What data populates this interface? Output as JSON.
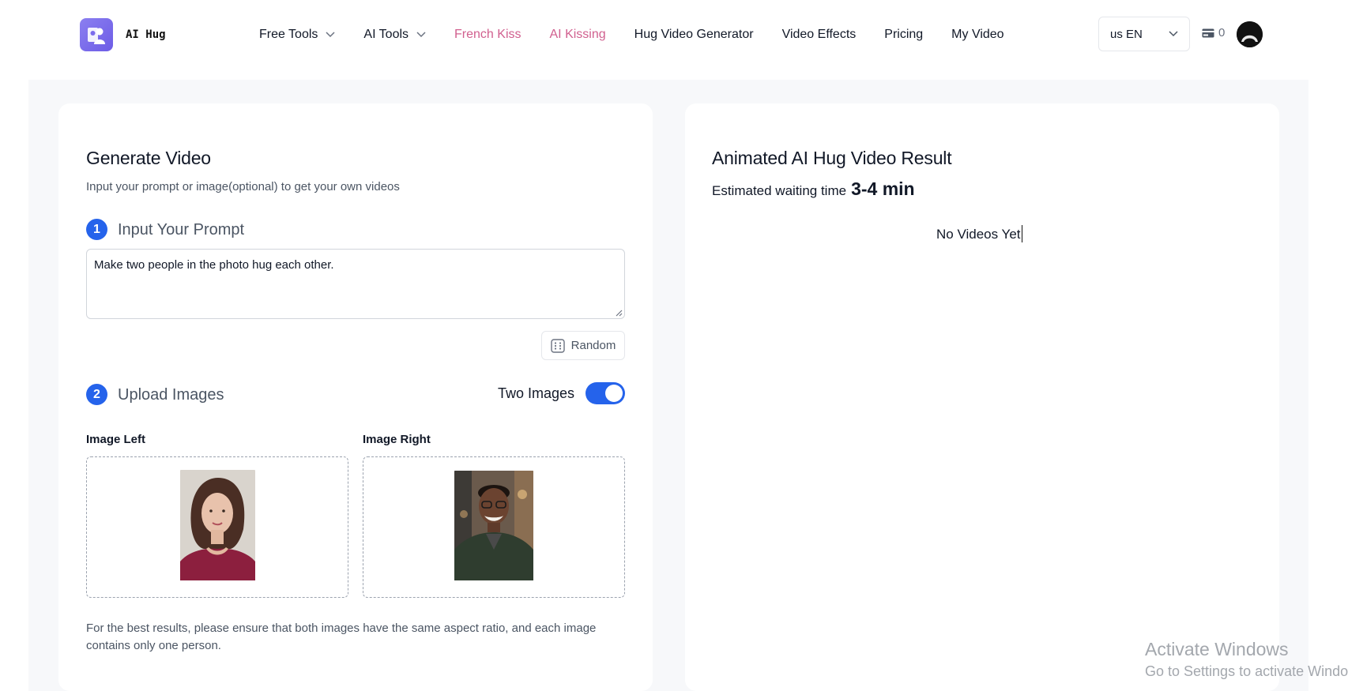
{
  "header": {
    "logo_text": "AI Hug",
    "nav": [
      {
        "label": "Free Tools",
        "dropdown": true,
        "color": "#111827"
      },
      {
        "label": "AI Tools",
        "dropdown": true,
        "color": "#111827"
      },
      {
        "label": "French Kiss",
        "dropdown": false,
        "color": "#d1608f"
      },
      {
        "label": "AI Kissing",
        "dropdown": false,
        "color": "#d1608f"
      },
      {
        "label": "Hug Video Generator",
        "dropdown": false,
        "color": "#111827"
      },
      {
        "label": "Video Effects",
        "dropdown": false,
        "color": "#111827"
      },
      {
        "label": "Pricing",
        "dropdown": false,
        "color": "#111827"
      },
      {
        "label": "My Video",
        "dropdown": false,
        "color": "#111827"
      }
    ],
    "language": "us EN",
    "credits": "0"
  },
  "generate": {
    "title": "Generate Video",
    "subtitle": "Input your prompt or image(optional) to get your own videos",
    "step1": {
      "number": "1",
      "title": "Input Your Prompt"
    },
    "prompt_value": "Make two people in the photo hug each other.",
    "random_label": "Random",
    "step2": {
      "number": "2",
      "title": "Upload Images"
    },
    "toggle_label": "Two Images",
    "toggle_on": true,
    "image_left_label": "Image Left",
    "image_right_label": "Image Right",
    "note": "For the best results, please ensure that both images have the same aspect ratio, and each image contains only one person."
  },
  "result": {
    "title": "Animated AI Hug Video Result",
    "est_prefix": "Estimated waiting time",
    "est_value": "3-4 min",
    "empty_text": "No Videos Yet"
  },
  "watermark": {
    "line1": "Activate Windows",
    "line2": "Go to Settings to activate Windows."
  },
  "colors": {
    "accent": "#2563eb",
    "pink_nav": "#d1608f",
    "logo": "#7b6cec",
    "page_bg": "#f7f8fa"
  }
}
